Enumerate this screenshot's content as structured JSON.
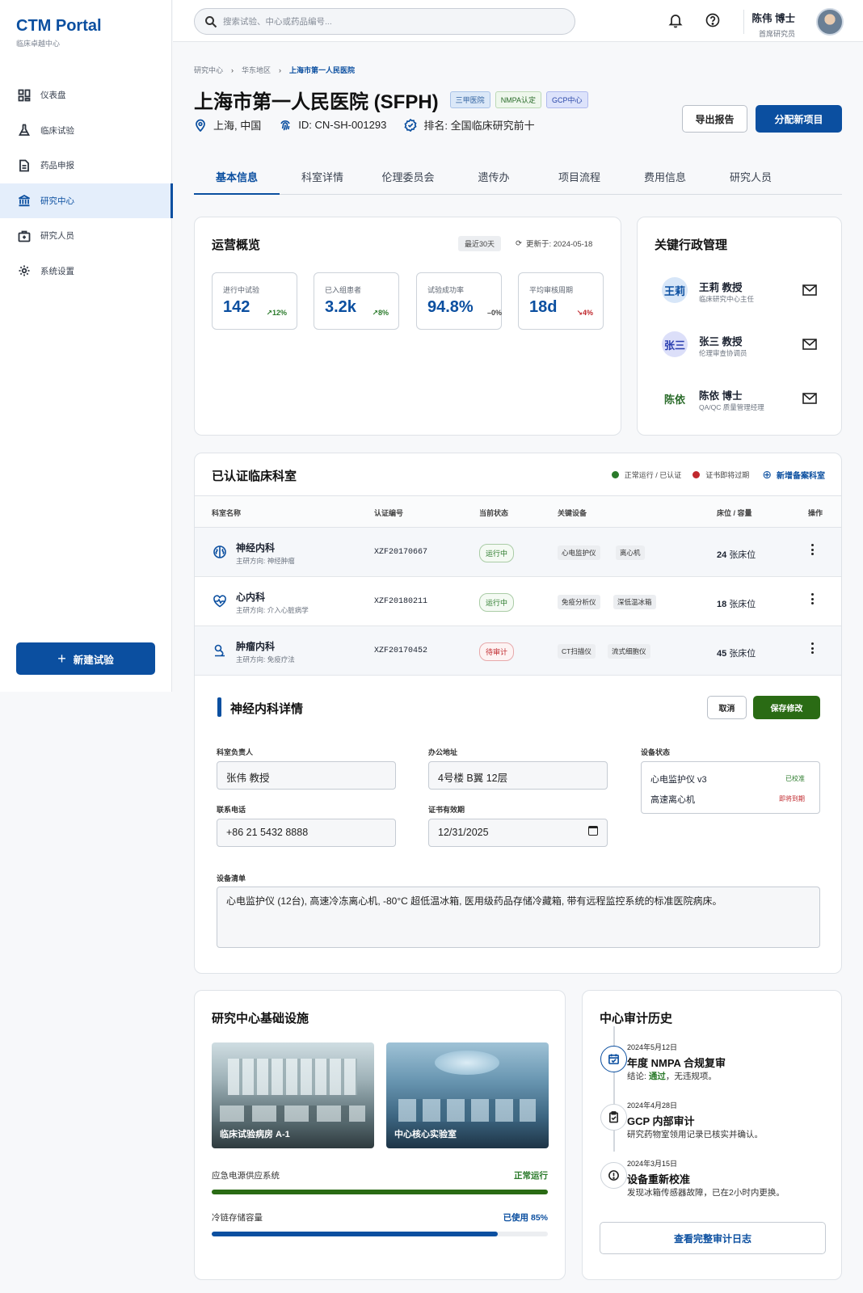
{
  "brand": {
    "title": "CTM Portal",
    "subtitle": "临床卓越中心"
  },
  "sidebar": {
    "items": [
      {
        "label": "仪表盘",
        "icon": "dashboard-icon"
      },
      {
        "label": "临床试验",
        "icon": "flask-icon"
      },
      {
        "label": "药品申报",
        "icon": "document-icon"
      },
      {
        "label": "研究中心",
        "icon": "institution-icon",
        "active": true
      },
      {
        "label": "研究人员",
        "icon": "medical-bag-icon"
      },
      {
        "label": "系统设置",
        "icon": "gear-icon"
      }
    ],
    "new_trial": "新建试验"
  },
  "topbar": {
    "search_placeholder": "搜索试验、中心或药品编号...",
    "user_name": "陈伟 博士",
    "user_role": "首席研究员"
  },
  "breadcrumb": [
    "研究中心",
    "华东地区",
    "上海市第一人民医院"
  ],
  "header": {
    "title": "上海市第一人民医院 (SFPH)",
    "tags": [
      "三甲医院",
      "NMPA认定",
      "GCP中心"
    ],
    "location": "上海, 中国",
    "id": "ID: CN-SH-001293",
    "rank": "排名: 全国临床研究前十",
    "export": "导出报告",
    "assign": "分配新项目"
  },
  "tabs": [
    "基本信息",
    "科室详情",
    "伦理委员会",
    "遗传办",
    "项目流程",
    "费用信息",
    "研究人员"
  ],
  "overview": {
    "title": "运营概览",
    "range": "最近30天",
    "updated": "更新于: 2024-05-18",
    "kpis": [
      {
        "label": "进行中试验",
        "value": "142",
        "delta": "12%",
        "trend": "up"
      },
      {
        "label": "已入组患者",
        "value": "3.2k",
        "delta": "8%",
        "trend": "up"
      },
      {
        "label": "试验成功率",
        "value": "94.8%",
        "delta": "0%",
        "trend": "flat"
      },
      {
        "label": "平均审核周期",
        "value": "18d",
        "delta": "4%",
        "trend": "down"
      }
    ]
  },
  "admin": {
    "title": "关键行政管理",
    "people": [
      {
        "avatar": "王莉",
        "name": "王莉 教授",
        "role": "临床研究中心主任",
        "bg": "#d7e6f8",
        "fg": "#0b4fa0"
      },
      {
        "avatar": "张三",
        "name": "张三 教授",
        "role": "伦理审查协调员",
        "bg": "#dcdff9",
        "fg": "#2a3fb0"
      },
      {
        "avatar": "陈依",
        "name": "陈依 博士",
        "role": "QA/QC 质量管理经理",
        "bg": "#ffffff",
        "fg": "#2a6b2a"
      }
    ]
  },
  "departments": {
    "title": "已认证临床科室",
    "legend_ok": "正常运行 / 已认证",
    "legend_warn": "证书即将过期",
    "add": "新增备案科室",
    "columns": [
      "科室名称",
      "认证编号",
      "当前状态",
      "关键设备",
      "床位 / 容量",
      "操作"
    ],
    "rows": [
      {
        "name": "神经内科",
        "focus": "主研方向: 神经肿瘤",
        "code": "XZF20170667",
        "status": "运行中",
        "status_type": "ok",
        "equipment": [
          "心电监护仪",
          "离心机"
        ],
        "beds": "24",
        "beds_unit": "张床位",
        "icon": "brain-icon"
      },
      {
        "name": "心内科",
        "focus": "主研方向: 介入心脏病学",
        "code": "XZF20180211",
        "status": "运行中",
        "status_type": "ok",
        "equipment": [
          "免疫分析仪",
          "深低温冰箱"
        ],
        "beds": "18",
        "beds_unit": "张床位",
        "icon": "heart-pulse-icon"
      },
      {
        "name": "肿瘤内科",
        "focus": "主研方向: 免疫疗法",
        "code": "XZF20170452",
        "status": "待审计",
        "status_type": "warn",
        "equipment": [
          "CT扫描仪",
          "流式细胞仪"
        ],
        "beds": "45",
        "beds_unit": "张床位",
        "icon": "microscope-icon"
      }
    ]
  },
  "detail": {
    "title": "神经内科详情",
    "cancel": "取消",
    "save": "保存修改",
    "head_label": "科室负责人",
    "head_value": "张伟 教授",
    "addr_label": "办公地址",
    "addr_value": "4号楼 B翼 12层",
    "equip_label": "设备状态",
    "equip": [
      {
        "name": "心电监护仪 v3",
        "status": "已校准",
        "color": "#2a7a2a"
      },
      {
        "name": "高速离心机",
        "status": "即将到期",
        "color": "#c0282d"
      }
    ],
    "phone_label": "联系电话",
    "phone_value": "+86 21 5432 8888",
    "cert_label": "证书有效期",
    "cert_value": "12/31/2025",
    "list_label": "设备清单",
    "list_value": "心电监护仪 (12台), 高速冷冻离心机, -80°C 超低温冰箱, 医用级药品存储冷藏箱, 带有远程监控系统的标准医院病床。"
  },
  "infra": {
    "title": "研究中心基础设施",
    "photos": [
      "临床试验病房 A-1",
      "中心核心实验室"
    ],
    "power_label": "应急电源供应系统",
    "power_status": "正常运行",
    "power_fill": 1.0,
    "cold_label": "冷链存储容量",
    "cold_status": "已使用 85%",
    "cold_fill": 0.85
  },
  "audit": {
    "title": "中心审计历史",
    "items": [
      {
        "date": "2024年5月12日",
        "title": "年度 NMPA 合规复审",
        "pre": "结论: ",
        "bold": "通过",
        "post": "，无违规项。",
        "icon": "calendar-check-icon"
      },
      {
        "date": "2024年4月28日",
        "title": "GCP 内部审计",
        "pre": "研究药物室领用记录已核实并确认。",
        "bold": "",
        "post": "",
        "icon": "clipboard-icon"
      },
      {
        "date": "2024年3月15日",
        "title": "设备重新校准",
        "pre": "发现冰箱传感器故障，已在2小时内更换。",
        "bold": "",
        "post": "",
        "icon": "alert-icon"
      }
    ],
    "view_all": "查看完整审计日志"
  },
  "colors": {
    "primary": "#0b4fa0",
    "success": "#2a7a2a",
    "danger": "#c0282d"
  }
}
